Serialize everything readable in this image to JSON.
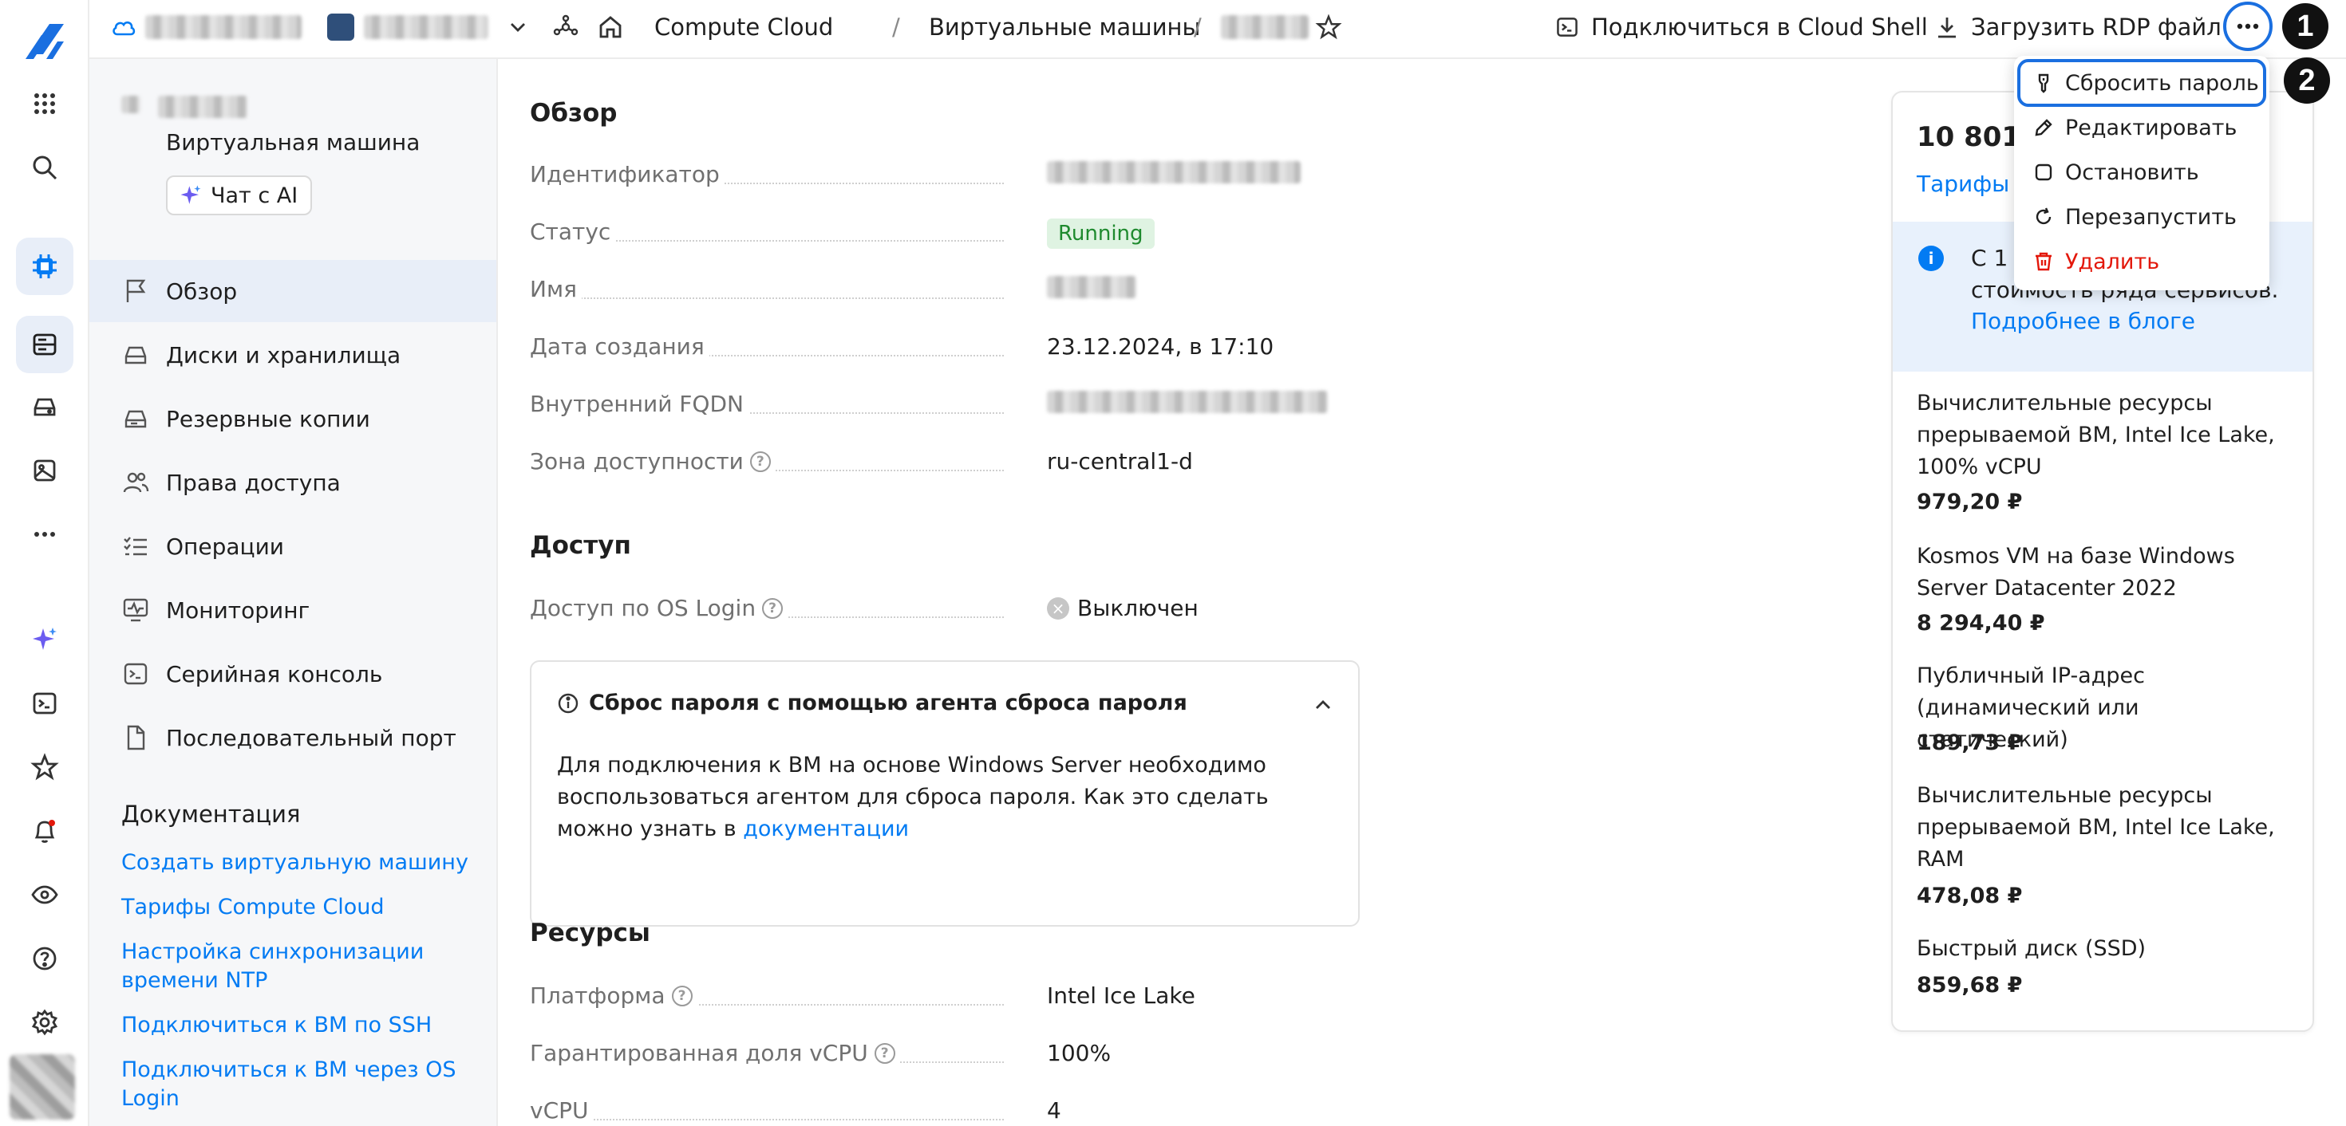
{
  "topbar": {
    "breadcrumb_service": "Compute Cloud",
    "breadcrumb_section": "Виртуальные машины",
    "cloud_shell_label": "Подключиться в Cloud Shell",
    "rdp_label": "Загрузить RDP файл"
  },
  "menu": {
    "items": [
      {
        "label": "Сбросить пароль",
        "icon": "key-icon"
      },
      {
        "label": "Редактировать",
        "icon": "pencil-icon"
      },
      {
        "label": "Остановить",
        "icon": "stop-icon"
      },
      {
        "label": "Перезапустить",
        "icon": "restart-icon"
      },
      {
        "label": "Удалить",
        "icon": "trash-icon",
        "color": "#e3170a"
      }
    ],
    "step1": "1",
    "step2": "2"
  },
  "nav": {
    "resource_type": "Виртуальная машина",
    "ai_chat": "Чат с AI",
    "items": [
      {
        "label": "Обзор",
        "icon": "flag-icon",
        "active": true
      },
      {
        "label": "Диски и хранилища",
        "icon": "disk-icon"
      },
      {
        "label": "Резервные копии",
        "icon": "backup-icon"
      },
      {
        "label": "Права доступа",
        "icon": "users-icon"
      },
      {
        "label": "Операции",
        "icon": "list-icon"
      },
      {
        "label": "Мониторинг",
        "icon": "monitor-icon"
      },
      {
        "label": "Серийная консоль",
        "icon": "console-icon"
      },
      {
        "label": "Последовательный порт",
        "icon": "file-icon"
      }
    ],
    "docs_title": "Документация",
    "docs": [
      "Создать виртуальную машину",
      "Тарифы Compute Cloud",
      "Настройка синхронизации времени NTP",
      "Подключиться к ВМ по SSH",
      "Подключиться к ВМ через OS Login"
    ]
  },
  "overview": {
    "title": "Обзор",
    "id_label": "Идентификатор",
    "status_label": "Статус",
    "status_value": "Running",
    "name_label": "Имя",
    "created_label": "Дата создания",
    "created_value": "23.12.2024, в 17:10",
    "fqdn_label": "Внутренний FQDN",
    "zone_label": "Зона доступности",
    "zone_value": "ru-central1-d"
  },
  "access": {
    "title": "Доступ",
    "oslogin_label": "Доступ по OS Login",
    "oslogin_value": "Выключен",
    "reset_title": "Сброс пароля с помощью агента сброса пароля",
    "reset_text": "Для подключения к ВМ на основе Windows Server необходимо воспользоваться агентом для сброса пароля. Как это сделать можно узнать в ",
    "reset_link": "документации"
  },
  "resources": {
    "title": "Ресурсы",
    "platform_label": "Платформа",
    "platform_value": "Intel Ice Lake",
    "vcpu_share_label": "Гарантированная доля vCPU",
    "vcpu_share_value": "100%",
    "vcpu_label": "vCPU",
    "vcpu_value": "4"
  },
  "price": {
    "total": "10 801,",
    "tariffs_link": "Тарифы и",
    "info_text_1": "С 1 ",
    "info_text_2": "стоимость ряда сервисов.",
    "info_link": "Подробнее в блоге",
    "items": [
      {
        "name": "Вычислительные ресурсы прерываемой ВМ, Intel Ice Lake, 100% vCPU",
        "value": "979,20 ₽"
      },
      {
        "name": "Kosmos VM на базе Windows Server Datacenter 2022",
        "value": "8 294,40 ₽"
      },
      {
        "name": "Публичный IP-адрес (динамический или статический)",
        "value": "189,73 ₽"
      },
      {
        "name": "Вычислительные ресурсы прерываемой ВМ, Intel Ice Lake, RAM",
        "value": "478,08 ₽"
      },
      {
        "name": "Быстрый диск (SSD)",
        "value": "859,68 ₽"
      }
    ]
  },
  "colors": {
    "accent": "#027bf3",
    "danger": "#e3170a",
    "success": "#1e8a2e"
  }
}
